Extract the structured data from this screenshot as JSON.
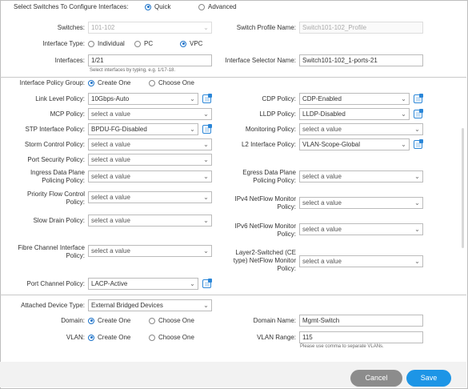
{
  "header": {
    "select_switches_label": "Select Switches To Configure Interfaces:",
    "mode_options": [
      "Quick",
      "Advanced"
    ]
  },
  "switches": {
    "label": "Switches:",
    "value": "101-102"
  },
  "profile_name": {
    "label": "Switch Profile Name:",
    "value": "Switch101-102_Profile"
  },
  "interface_type": {
    "label": "Interface Type:",
    "options": [
      "Individual",
      "PC",
      "VPC"
    ]
  },
  "interfaces": {
    "label": "Interfaces:",
    "value": "1/21",
    "hint": "Select interfaces by typing, e.g. 1/17-18."
  },
  "selector_name": {
    "label": "Interface Selector Name:",
    "value": "Switch101-102_1-ports-21"
  },
  "policy_group": {
    "label": "Interface Policy Group:",
    "options": [
      "Create One",
      "Choose One"
    ]
  },
  "placeholder": "select a value",
  "left_policies": [
    {
      "label": "Link Level Policy:",
      "value": "10Gbps-Auto"
    },
    {
      "label": "MCP Policy:",
      "value": "select a value"
    },
    {
      "label": "STP Interface Policy:",
      "value": "BPDU-FG-Disabled"
    },
    {
      "label": "Storm Control Policy:",
      "value": "select a value"
    },
    {
      "label": "Port Security Policy:",
      "value": "select a value"
    },
    {
      "label": "Ingress Data Plane Policing Policy:",
      "value": "select a value"
    },
    {
      "label": "Priority Flow Control Policy:",
      "value": "select a value"
    },
    {
      "label": "Slow Drain Policy:",
      "value": "select a value"
    },
    {
      "label": "Fibre Channel Interface Policy:",
      "value": "select a value"
    },
    {
      "label": "Port Channel Policy:",
      "value": "LACP-Active"
    }
  ],
  "right_policies": [
    {
      "label": "CDP Policy:",
      "value": "CDP-Enabled"
    },
    {
      "label": "LLDP Policy:",
      "value": "LLDP-Disabled"
    },
    {
      "label": "Monitoring Policy:",
      "value": "select a value"
    },
    {
      "label": "L2 Interface Policy:",
      "value": "VLAN-Scope-Global"
    },
    {
      "label": "Egress Data Plane Policing Policy:",
      "value": "select a value"
    },
    {
      "label": "IPv4 NetFlow Monitor Policy:",
      "value": "select a value"
    },
    {
      "label": "IPv6 NetFlow Monitor Policy:",
      "value": "select a value"
    },
    {
      "label": "Layer2-Switched (CE type) NetFlow Monitor Policy:",
      "value": "select a value"
    }
  ],
  "attached_device": {
    "label": "Attached Device Type:",
    "value": "External Bridged Devices"
  },
  "domain": {
    "label": "Domain:",
    "options": [
      "Create One",
      "Choose One"
    ]
  },
  "domain_name": {
    "label": "Domain Name:",
    "value": "Mgmt-Switch"
  },
  "vlan": {
    "label": "VLAN:",
    "options": [
      "Create One",
      "Choose One"
    ]
  },
  "vlan_range": {
    "label": "VLAN Range:",
    "value": "115",
    "hint": "Please use comma to separate VLANs."
  },
  "buttons": {
    "cancel": "Cancel",
    "save": "Save"
  },
  "colors": {
    "accent": "#1d95e6",
    "cancel": "#8c8c8c"
  }
}
